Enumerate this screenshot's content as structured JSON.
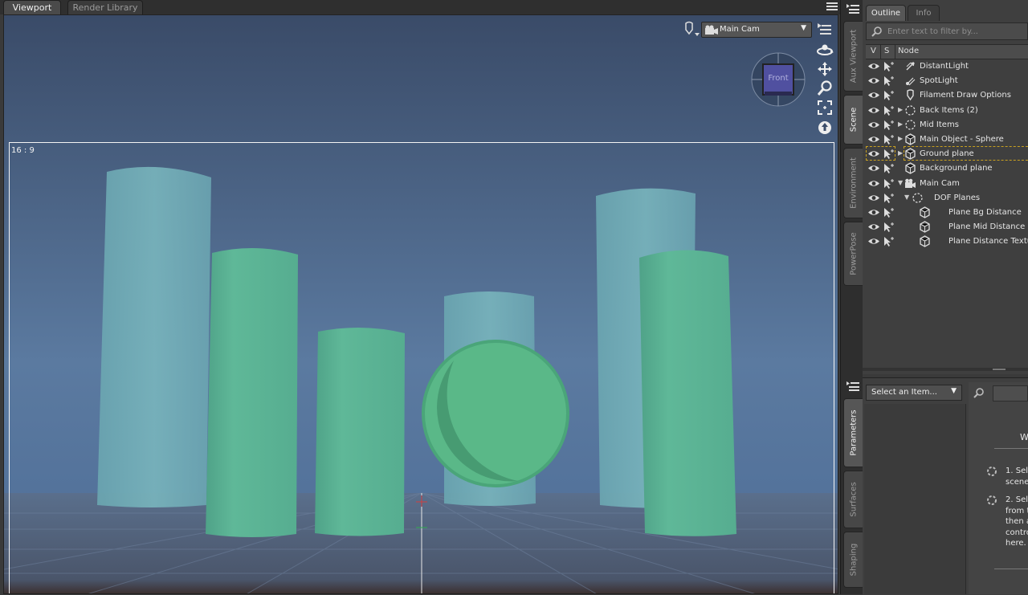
{
  "tabs": {
    "viewport": "Viewport",
    "render_library": "Render Library"
  },
  "viewport": {
    "aspect_label": "16 : 9",
    "camera": "Main Cam",
    "nav_cube_label": "Front",
    "tool_icons": [
      "orbit-icon",
      "pan-icon",
      "zoom-icon",
      "frame-icon",
      "reset-view-icon"
    ]
  },
  "side_tabs": {
    "top": [
      "Aux Viewport",
      "Scene",
      "Environment",
      "PowerPose"
    ],
    "bottom": [
      "Parameters",
      "Surfaces",
      "Shaping"
    ],
    "active_top": "Scene",
    "active_bottom": "Parameters"
  },
  "outline": {
    "tabs": [
      "Outline",
      "Info"
    ],
    "filter_placeholder": "Enter text to filter by...",
    "columns": [
      "V",
      "S",
      "Node"
    ],
    "nodes": [
      {
        "label": "DistantLight",
        "icon": "distant-light-icon",
        "expander": "",
        "level": 0
      },
      {
        "label": "SpotLight",
        "icon": "spotlight-icon",
        "expander": "",
        "level": 0
      },
      {
        "label": "Filament Draw Options",
        "icon": "draw-options-icon",
        "expander": "",
        "level": 0
      },
      {
        "label": "Back Items (2)",
        "icon": "group-icon",
        "expander": "▶",
        "level": 0
      },
      {
        "label": "Mid Items",
        "icon": "group-icon",
        "expander": "▶",
        "level": 0
      },
      {
        "label": "Main Object - Sphere",
        "icon": "object-icon",
        "expander": "▶",
        "level": 0
      },
      {
        "label": "Ground plane",
        "icon": "object-icon",
        "expander": "▶",
        "level": 0,
        "selected": true
      },
      {
        "label": "Background plane",
        "icon": "object-icon",
        "expander": "",
        "level": 0
      },
      {
        "label": "Main Cam",
        "icon": "camera-icon",
        "expander": "▼",
        "level": 0
      },
      {
        "label": "DOF Planes",
        "icon": "group-icon",
        "expander": "▼",
        "level": 1
      },
      {
        "label": "Plane Bg Distance",
        "icon": "object-icon",
        "expander": "",
        "level": 2
      },
      {
        "label": "Plane Mid Distance",
        "icon": "object-icon",
        "expander": "",
        "level": 2
      },
      {
        "label": "Plane Distance Texture",
        "icon": "object-icon",
        "expander": "",
        "level": 2
      }
    ]
  },
  "parameters": {
    "select_label": "Select an Item...",
    "heading_fragment": "W",
    "step1": [
      "1. Sel",
      "scene"
    ],
    "step2": [
      "2. Sel",
      "from t",
      "then a",
      "contro",
      "here."
    ]
  },
  "colors": {
    "cyl_back": "#6fa8b2",
    "cyl_front": "#5aae92",
    "sphere": "#56b584",
    "frame": "#f4f4f4",
    "selection": "#c8a020"
  }
}
